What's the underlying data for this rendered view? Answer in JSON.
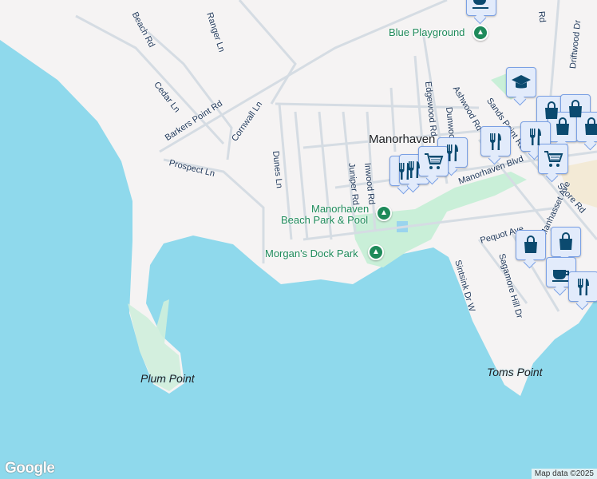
{
  "places": {
    "town": "Manorhaven",
    "parks": [
      "Blue Playground",
      "Manorhaven",
      "Beach Park & Pool",
      "Morgan's Dock Park"
    ],
    "points": [
      "Plum Point",
      "Toms Point"
    ]
  },
  "streets": [
    "Cedar Ln",
    "Barkers Point Rd",
    "Prospect Ln",
    "Cornwall Ln",
    "Dunes Ln",
    "Juniper Rd",
    "Inwood Rd",
    "Edgewood Rd",
    "Dunwood Rd",
    "Ashwood Rd",
    "Sands Point Rd",
    "Manorhaven Blvd",
    "Shore Rd",
    "Pequot Ave",
    "Sintsink Dr W",
    "Sagamore Hill Dr",
    "Manhasset Ave",
    "Driftwood Dr",
    "Beach Rd",
    "Ranger Ln",
    "Rd"
  ],
  "markers": [
    "coffee",
    "education",
    "shopping",
    "shopping",
    "shopping",
    "shopping",
    "restaurant",
    "restaurant",
    "restaurant",
    "restaurant",
    "restaurant",
    "cart",
    "cart",
    "shopping",
    "shopping",
    "cafe",
    "restaurant"
  ],
  "footer": {
    "logo": "Google",
    "attribution": "Map data ©2025"
  },
  "colors": {
    "water": "#8fd9ec",
    "land": "#f5f3f3",
    "park": "#c9efd8",
    "marker_bg": "#e2ebfb",
    "icon": "#0b4a6f"
  }
}
